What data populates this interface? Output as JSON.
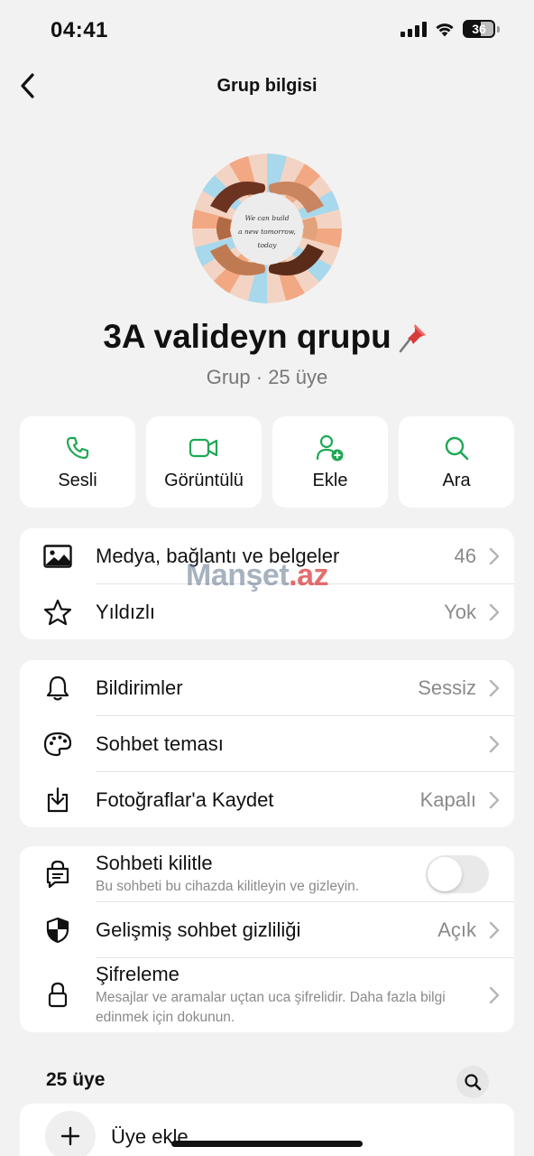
{
  "status_bar": {
    "time": "04:41",
    "battery": "36"
  },
  "nav": {
    "title": "Grup bilgisi"
  },
  "avatar": {
    "line1": "We can build",
    "line2": "a new tomorrow,",
    "line3": "today"
  },
  "group": {
    "name": "3A valideyn qrupu",
    "pin_icon": "pushpin-icon",
    "subtitle": "Grup · 25 üye"
  },
  "actions": [
    {
      "label": "Sesli",
      "icon": "phone-icon"
    },
    {
      "label": "Görüntülü",
      "icon": "video-icon"
    },
    {
      "label": "Ekle",
      "icon": "add-person-icon"
    },
    {
      "label": "Ara",
      "icon": "search-icon"
    }
  ],
  "media_section": [
    {
      "label": "Medya, bağlantı ve belgeler",
      "value": "46",
      "icon": "image-icon"
    },
    {
      "label": "Yıldızlı",
      "value": "Yok",
      "icon": "star-icon"
    }
  ],
  "settings_section": [
    {
      "label": "Bildirimler",
      "value": "Sessiz",
      "icon": "bell-icon"
    },
    {
      "label": "Sohbet teması",
      "value": "",
      "icon": "palette-icon"
    },
    {
      "label": "Fotoğraflar'a Kaydet",
      "value": "Kapalı",
      "icon": "download-icon"
    }
  ],
  "privacy_section": {
    "lock_chat": {
      "label": "Sohbeti kilitle",
      "sub": "Bu sohbeti bu cihazda kilitleyin ve gizleyin.",
      "toggle_on": false,
      "icon": "lock-chat-icon"
    },
    "advanced": {
      "label": "Gelişmiş sohbet gizliliği",
      "value": "Açık",
      "icon": "shield-icon"
    },
    "encryption": {
      "label": "Şifreleme",
      "sub": "Mesajlar ve aramalar uçtan uca şifrelidir. Daha fazla bilgi edinmek için dokunun.",
      "icon": "lock-icon"
    }
  },
  "members": {
    "header": "25 üye",
    "add_label": "Üye ekle"
  },
  "watermark": {
    "part1": "Manşet",
    "part2": ".az"
  },
  "colors": {
    "accent_green": "#1fa855",
    "background": "#f2f2f2"
  }
}
